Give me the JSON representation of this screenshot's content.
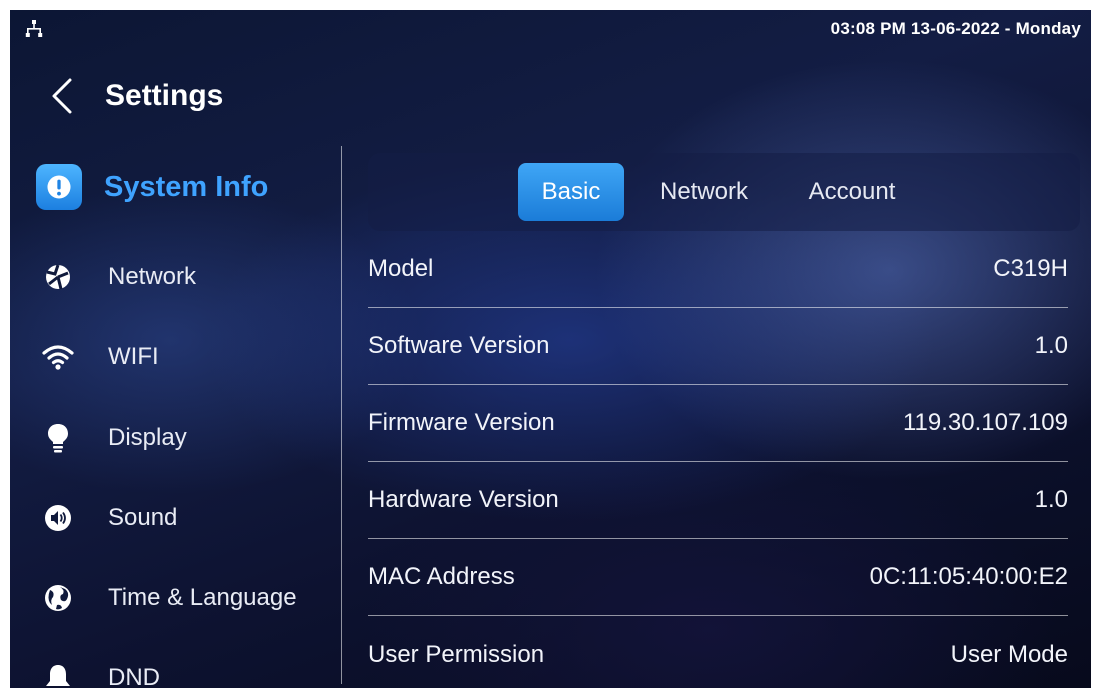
{
  "status_bar": {
    "datetime": "03:08 PM  13-06-2022 - Monday"
  },
  "header": {
    "title": "Settings"
  },
  "sidebar": {
    "items": [
      {
        "label": "System Info",
        "icon": "info-icon",
        "active": true
      },
      {
        "label": "Network",
        "icon": "network-globe-icon"
      },
      {
        "label": "WIFI",
        "icon": "wifi-icon"
      },
      {
        "label": "Display",
        "icon": "lightbulb-icon"
      },
      {
        "label": "Sound",
        "icon": "speaker-icon"
      },
      {
        "label": "Time & Language",
        "icon": "globe-icon"
      },
      {
        "label": "DND",
        "icon": "bell-icon"
      }
    ]
  },
  "tabs": [
    {
      "label": "Basic",
      "active": true
    },
    {
      "label": "Network"
    },
    {
      "label": "Account"
    }
  ],
  "info": {
    "rows": [
      {
        "label": "Model",
        "value": "C319H"
      },
      {
        "label": "Software Version",
        "value": "1.0"
      },
      {
        "label": "Firmware Version",
        "value": "119.30.107.109"
      },
      {
        "label": "Hardware Version",
        "value": "1.0"
      },
      {
        "label": "MAC Address",
        "value": "0C:11:05:40:00:E2"
      },
      {
        "label": "User Permission",
        "value": "User Mode"
      }
    ]
  },
  "colors": {
    "accent": "#3fa3ff",
    "tab_active": "#2a8fe6",
    "background": "#0d1532"
  }
}
